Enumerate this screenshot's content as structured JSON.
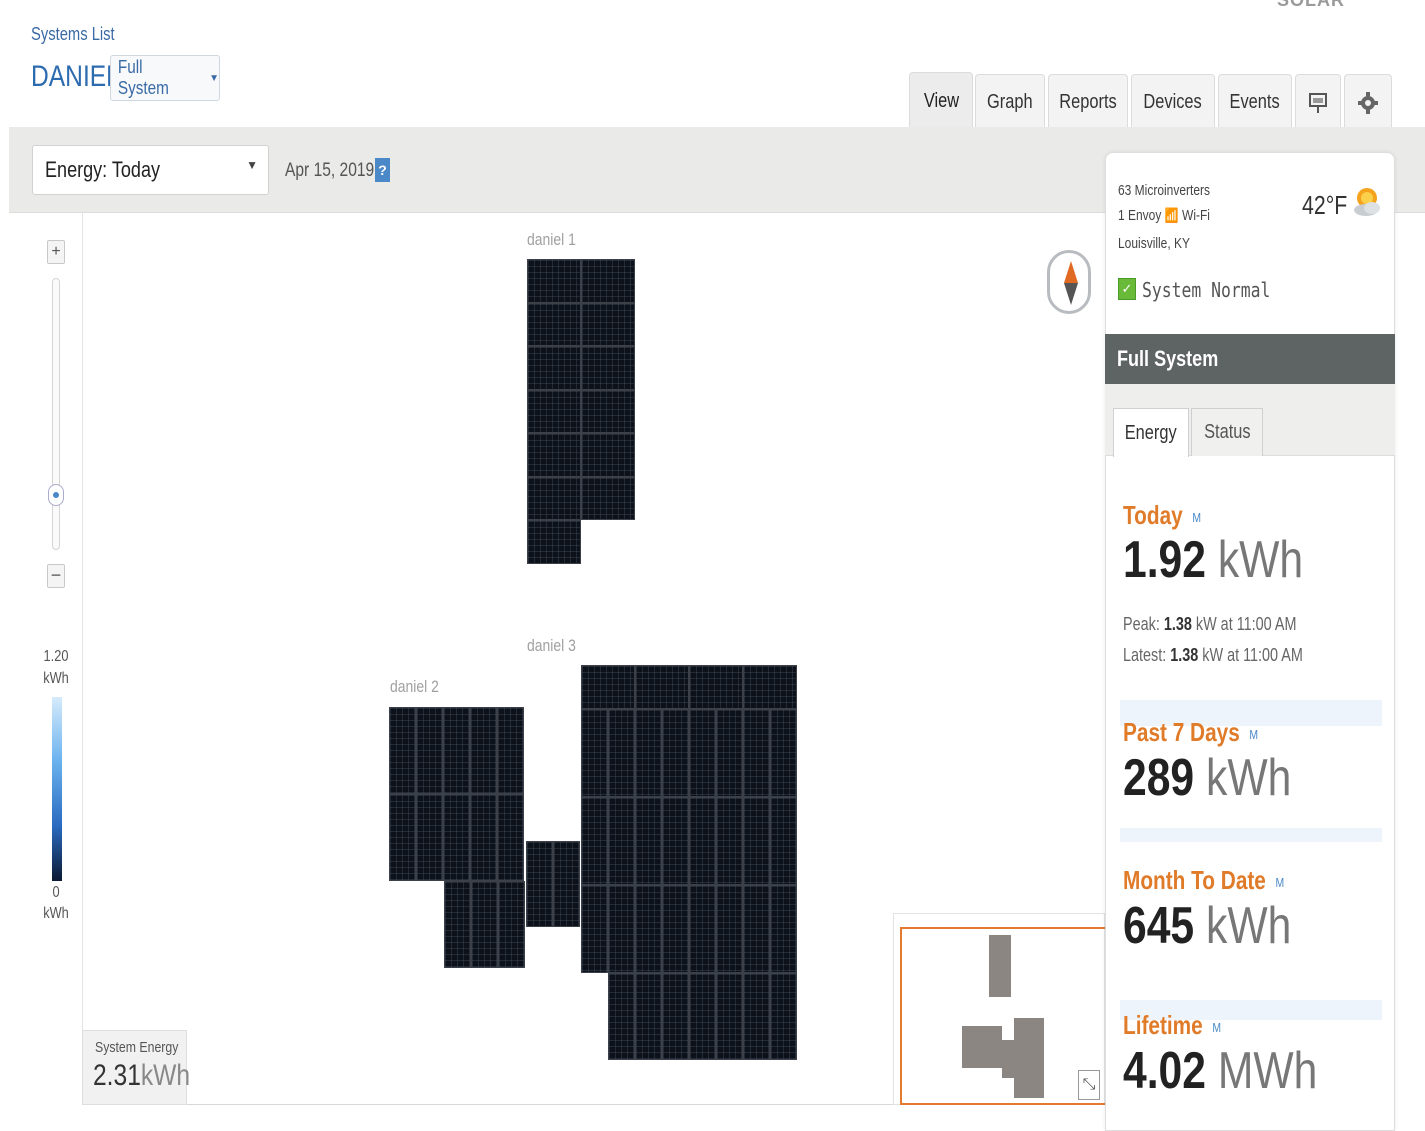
{
  "header": {
    "systems_list": "Systems List",
    "system_name": "DANIEL",
    "system_select": "Full System",
    "logo_text": "SOLAR"
  },
  "tabs": [
    {
      "label": "View",
      "active": true
    },
    {
      "label": "Graph"
    },
    {
      "label": "Reports"
    },
    {
      "label": "Devices"
    },
    {
      "label": "Events"
    },
    {
      "label": "",
      "icon": "presentation-icon"
    },
    {
      "label": "",
      "icon": "gear-icon"
    }
  ],
  "toolbar": {
    "energy_select": "Energy: Today",
    "date": "Apr 15, 2019",
    "help": "?"
  },
  "map": {
    "zoom_in": "+",
    "zoom_out": "−",
    "zoom_level": 0.22,
    "legend_max": "1.20",
    "legend_min": "0",
    "legend_unit": "kWh",
    "arrays": [
      "daniel 1",
      "daniel 2",
      "daniel 3"
    ],
    "system_energy_label": "System Energy",
    "system_energy_value": "2.31",
    "system_energy_unit": "kWh"
  },
  "side": {
    "microinverters": "63 Microinverters",
    "envoy": "1 Envoy",
    "wifi": "Wi-Fi",
    "location": "Louisville, KY",
    "temperature": "42°F",
    "status": "System Normal",
    "section_title": "Full System",
    "subtabs": [
      "Energy",
      "Status"
    ],
    "today_label": "Today",
    "today_value": "1.92",
    "today_unit": "kWh",
    "peak_label": "Peak:",
    "peak_value": "1.38",
    "peak_rest": "kW at 11:00 AM",
    "latest_label": "Latest:",
    "latest_value": "1.38",
    "latest_rest": "kW at 11:00 AM",
    "past7_label": "Past 7 Days",
    "past7_value": "289",
    "past7_unit": "kWh",
    "month_label": "Month To Date",
    "month_value": "645",
    "month_unit": "kWh",
    "lifetime_label": "Lifetime",
    "lifetime_value": "4.02",
    "lifetime_unit": "MWh",
    "m_marker": "M"
  },
  "colors": {
    "accent_blue": "#2d6bb0",
    "stat_orange": "#e07b2a",
    "panel_dark": "#0d1119",
    "status_green": "#6aba3a"
  }
}
